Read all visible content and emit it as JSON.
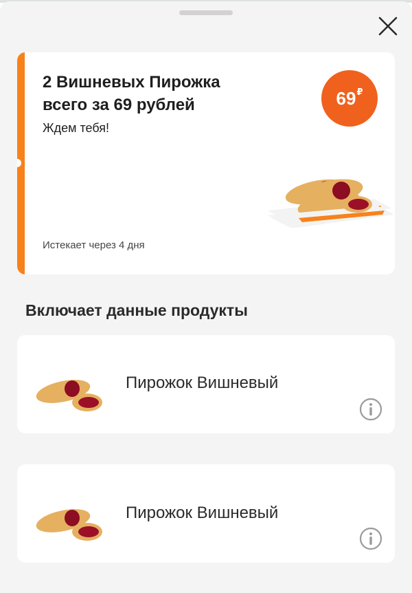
{
  "header": {
    "close_icon": "close-icon"
  },
  "offer": {
    "title": "2 Вишневых Пирожка всего за 69 рублей",
    "subtitle": "Ждем тебя!",
    "expiry": "Истекает через 4 дня",
    "price": "69",
    "currency": "₽",
    "accent_color": "#f7821b",
    "badge_color": "#f0611d"
  },
  "section": {
    "title": "Включает данные продукты"
  },
  "products": [
    {
      "name": "Пирожок Вишневый",
      "icon": "info-icon"
    },
    {
      "name": "Пирожок Вишневый",
      "icon": "info-icon"
    }
  ]
}
